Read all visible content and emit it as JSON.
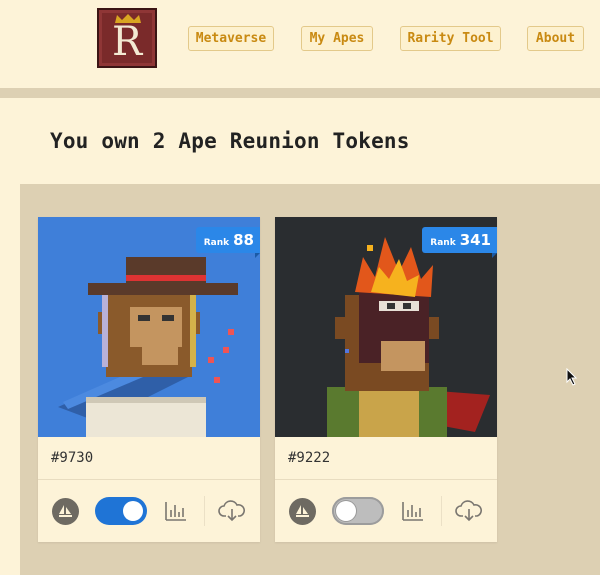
{
  "header": {
    "logo_letter": "R",
    "nav": [
      {
        "label": "Metaverse"
      },
      {
        "label": "My Apes"
      },
      {
        "label": "Rarity Tool"
      },
      {
        "label": "About"
      }
    ]
  },
  "main": {
    "title": "You own 2 Ape Reunion Tokens"
  },
  "cards": [
    {
      "rank_label": "Rank",
      "rank": "88",
      "token_id": "#9730",
      "toggle_on": true,
      "image_bg": "#3f7fd9"
    },
    {
      "rank_label": "Rank",
      "rank": "341",
      "token_id": "#9222",
      "toggle_on": false,
      "image_bg": "#2a2d30"
    }
  ],
  "icons": {
    "opensea": "opensea-icon",
    "stats": "bar-chart-icon",
    "download": "cloud-download-icon",
    "cursor": "mouse-pointer-icon"
  },
  "colors": {
    "background": "#fdf3d8",
    "panel": "#ddd0b3",
    "nav_text": "#c98a12",
    "rank_badge": "#2b87e8",
    "toggle_on": "#1f74d6"
  }
}
